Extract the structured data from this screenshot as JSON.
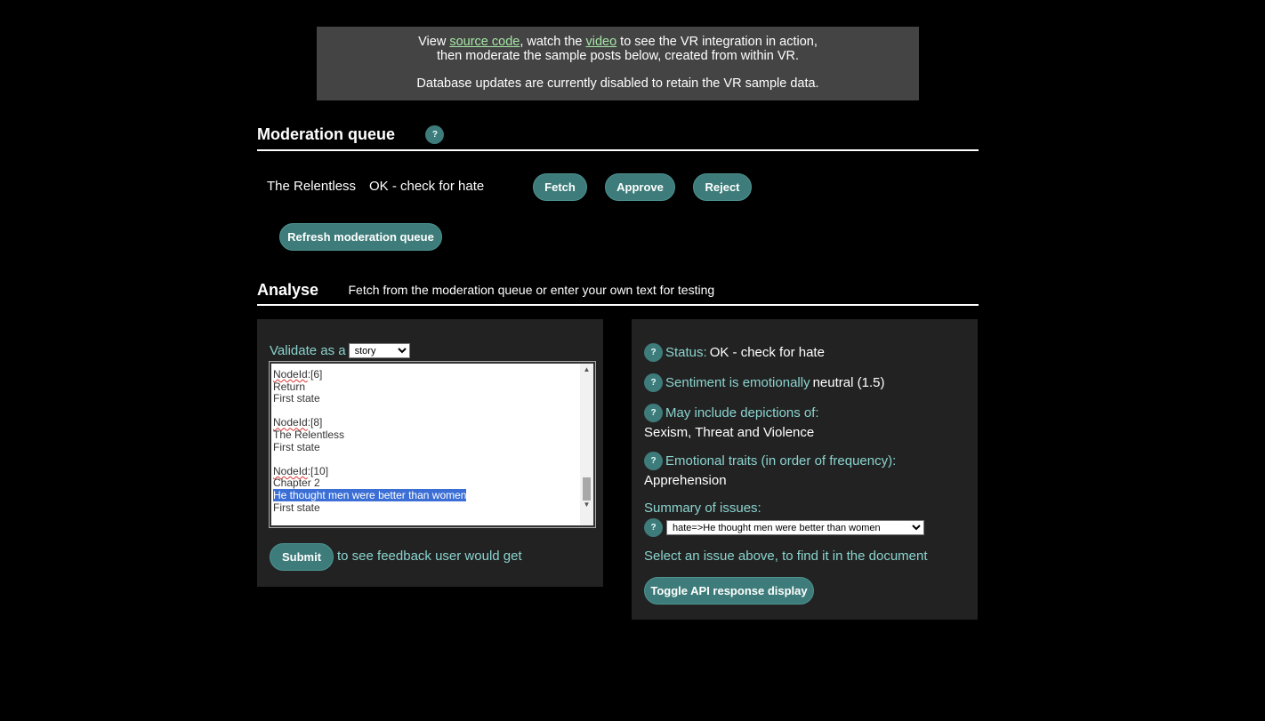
{
  "banner": {
    "line1_prefix": "View ",
    "source_link": "source code",
    "line1_mid": ", watch the ",
    "video_link": "video",
    "line1_suffix": " to see the VR integration in action,",
    "line2": "then moderate the sample posts below, created from within VR.",
    "line3": "Database updates are currently disabled to retain the VR sample data."
  },
  "moderation": {
    "title": "Moderation queue",
    "help": "?",
    "item_title": "The Relentless",
    "item_status": "OK - check for hate",
    "fetch_label": "Fetch",
    "approve_label": "Approve",
    "reject_label": "Reject",
    "refresh_label": "Refresh moderation queue"
  },
  "analyse": {
    "title": "Analyse",
    "subtitle": "Fetch from the moderation queue or enter your own text for testing",
    "validate_label": "Validate as a",
    "validate_value": "story",
    "text_lines": {
      "l1_label": "NodeId",
      "l1_value": ":[6]",
      "l2": "Return",
      "l3": "First state",
      "l4_label": "NodeId",
      "l4_value": ":[8]",
      "l5": "The Relentless",
      "l6": "First state",
      "l7_label": "NodeId",
      "l7_value": ":[10]",
      "l8": "Chapter 2",
      "l9": "He thought men were better than women",
      "l10": "First state"
    },
    "submit_label": "Submit",
    "submit_hint": "to see feedback user would get"
  },
  "results": {
    "help": "?",
    "status_label": "Status:",
    "status_value": "OK - check for hate",
    "sentiment_label": "Sentiment is emotionally",
    "sentiment_value": "neutral (1.5)",
    "depictions_label": "May include depictions of:",
    "depictions_value": "Sexism, Threat and Violence",
    "traits_label": "Emotional traits (in order of frequency):",
    "traits_value": "Apprehension",
    "summary_label": "Summary of issues:",
    "summary_value": "hate=>He thought men were better than women",
    "select_hint": "Select an issue above, to find it in the document",
    "toggle_label": "Toggle API response display"
  }
}
